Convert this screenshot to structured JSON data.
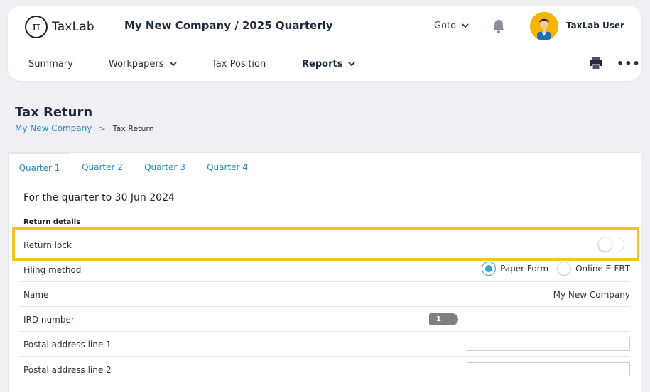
{
  "header": {
    "logo_text": "TaxLab",
    "logo_symbol": "π",
    "title": "My New Company / 2025 Quarterly",
    "goto_label": "Goto",
    "user_name": "TaxLab User"
  },
  "nav": {
    "items": [
      {
        "label": "Summary",
        "has_dropdown": false
      },
      {
        "label": "Workpapers",
        "has_dropdown": true
      },
      {
        "label": "Tax Position",
        "has_dropdown": false
      },
      {
        "label": "Reports",
        "has_dropdown": true
      }
    ]
  },
  "page": {
    "title": "Tax Return",
    "breadcrumb": {
      "link": "My New Company",
      "separator": ">",
      "current": "Tax Return"
    }
  },
  "tabs": [
    {
      "label": "Quarter 1",
      "active": true
    },
    {
      "label": "Quarter 2",
      "active": false
    },
    {
      "label": "Quarter 3",
      "active": false
    },
    {
      "label": "Quarter 4",
      "active": false
    }
  ],
  "period_text": "For the quarter to 30 Jun 2024",
  "section_label": "Return details",
  "rows": {
    "return_lock": {
      "label": "Return lock",
      "enabled": false
    },
    "filing_method": {
      "label": "Filing method",
      "options": [
        {
          "label": "Paper Form",
          "selected": true
        },
        {
          "label": "Online E-FBT",
          "selected": false
        }
      ]
    },
    "name": {
      "label": "Name",
      "value": "My New Company"
    },
    "ird": {
      "label": "IRD number",
      "badge": "1"
    },
    "postal1": {
      "label": "Postal address line 1",
      "value": ""
    },
    "postal2": {
      "label": "Postal address line 2",
      "value": ""
    }
  },
  "colors": {
    "accent": "#2a8ac8",
    "highlight": "#f5c518",
    "radio": "#2fa4d8",
    "avatar_bg": "#f5b400"
  }
}
